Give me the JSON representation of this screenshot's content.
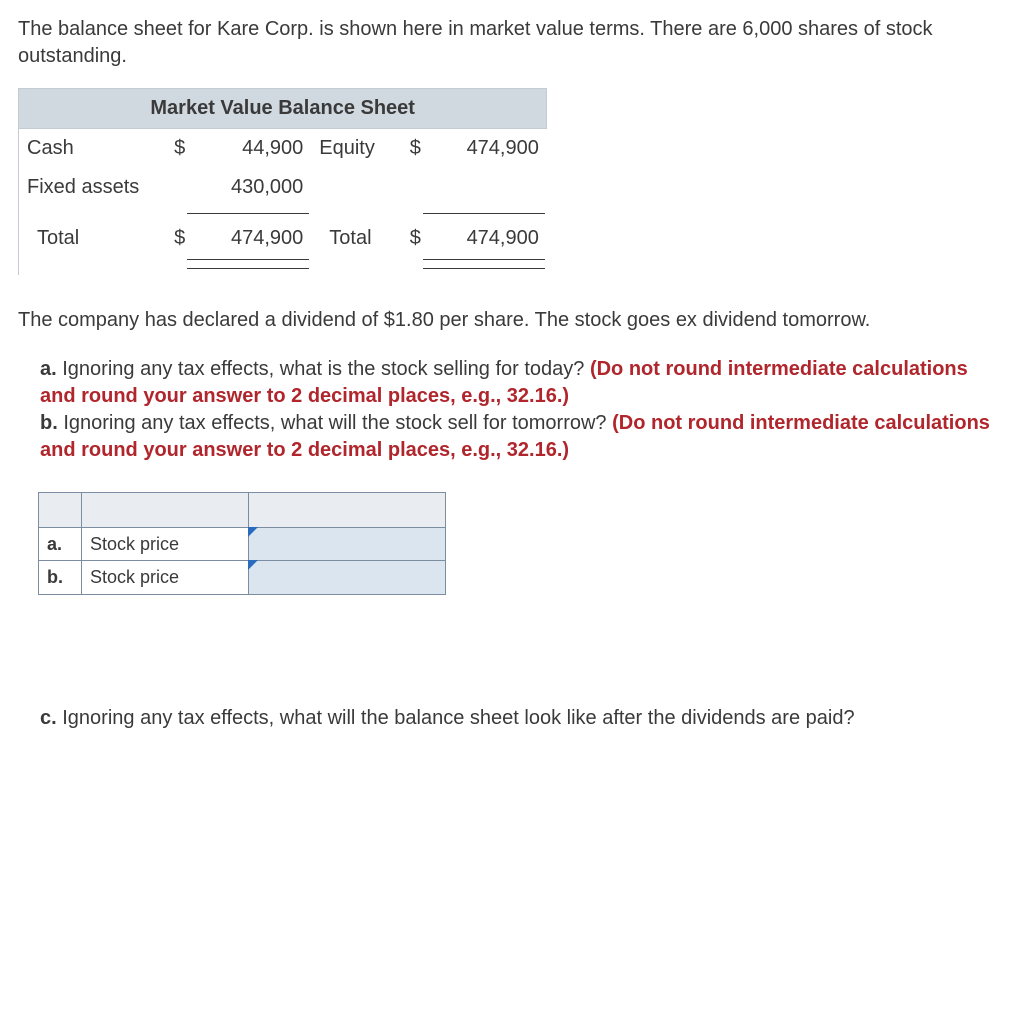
{
  "intro": "The balance sheet for Kare Corp. is shown here in market value terms. There are 6,000 shares of stock outstanding.",
  "balance": {
    "title": "Market Value Balance Sheet",
    "r1": {
      "a_label": "Cash",
      "a_dollar": "$",
      "a_val": "44,900",
      "l_label": "Equity",
      "l_dollar": "$",
      "l_val": "474,900"
    },
    "r2": {
      "a_label": "Fixed assets",
      "a_val": "430,000"
    },
    "tot": {
      "a_label": "Total",
      "a_dollar": "$",
      "a_val": "474,900",
      "l_label": "Total",
      "l_dollar": "$",
      "l_val": "474,900"
    }
  },
  "para2": "The company has declared a dividend of $1.80 per share. The stock goes ex dividend tomorrow.",
  "qa": {
    "a_lab": "a.",
    "a_text": "Ignoring any tax effects, what is the stock selling for today? ",
    "a_hint": "(Do not round intermediate calculations and round your answer to 2 decimal places, e.g., 32.16.)",
    "b_lab": "b.",
    "b_text": "Ignoring any tax effects, what will the stock sell for tomorrow? ",
    "b_hint": "(Do not round intermediate calculations and round your answer to 2 decimal places, e.g., 32.16.)"
  },
  "answers": {
    "a_lab": "a.",
    "a_desc": "Stock price",
    "b_lab": "b.",
    "b_desc": "Stock price"
  },
  "qc": {
    "c_lab": "c.",
    "c_text": "Ignoring any tax effects, what will the balance sheet look like after the dividends are paid?"
  }
}
